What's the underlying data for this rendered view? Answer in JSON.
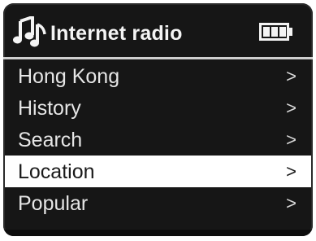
{
  "header": {
    "title": "Internet radio",
    "music_icon": "music-note-icon",
    "battery_icon": "battery-full-icon"
  },
  "menu": {
    "items": [
      {
        "label": "Hong Kong",
        "chevron": ">",
        "selected": false
      },
      {
        "label": "History",
        "chevron": ">",
        "selected": false
      },
      {
        "label": "Search",
        "chevron": ">",
        "selected": false
      },
      {
        "label": "Location",
        "chevron": ">",
        "selected": true
      },
      {
        "label": "Popular",
        "chevron": ">",
        "selected": false
      }
    ]
  },
  "colors": {
    "screen_background": "#161616",
    "text": "#e6e6e6",
    "highlight_background": "#ffffff",
    "highlight_text": "#1a1a1a"
  }
}
